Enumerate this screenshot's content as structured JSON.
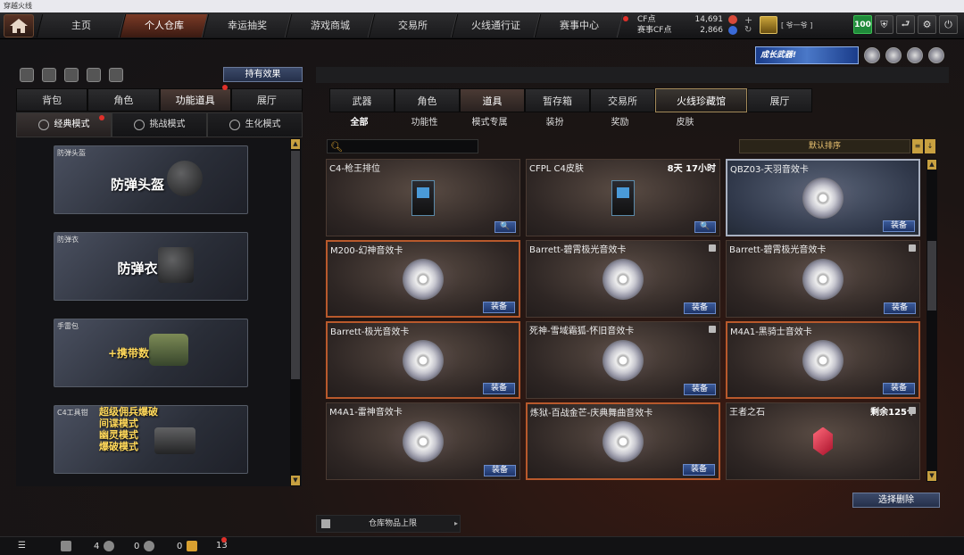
{
  "window": {
    "title": "穿越火线"
  },
  "nav": {
    "tabs": [
      "主页",
      "个人仓库",
      "幸运抽奖",
      "游戏商城",
      "交易所",
      "火线通行证",
      "赛事中心"
    ],
    "active_index": 1
  },
  "currency": {
    "cf_label": "CF点",
    "cf_value": "14,691",
    "event_label": "赛事CF点",
    "event_value": "2,866"
  },
  "rank": {
    "label": "[ 爷一爷 ]"
  },
  "level_badge": "100",
  "banner": {
    "text": "成长武器!"
  },
  "left": {
    "effect_button": "持有效果",
    "tabs": [
      "背包",
      "角色",
      "功能道具",
      "展厅"
    ],
    "active_tab_index": 2,
    "modes": [
      "经典模式",
      "挑战模式",
      "生化模式"
    ],
    "active_mode_index": 0,
    "cards": [
      {
        "name": "防弹头盔",
        "art": "防弹头盔"
      },
      {
        "name": "防弹衣",
        "art": "防弹衣"
      },
      {
        "name": "手雷包",
        "art": "+携带数"
      },
      {
        "name": "C4工具钳",
        "art_lines": [
          "超级佣兵爆破",
          "间谍模式",
          "幽灵模式",
          "爆破模式"
        ]
      }
    ]
  },
  "right": {
    "tabs": [
      "武器",
      "角色",
      "道具",
      "暂存箱",
      "交易所",
      "火线珍藏馆",
      "展厅"
    ],
    "active_tab_index": 2,
    "subtabs": [
      "全部",
      "功能性",
      "模式专属",
      "装扮",
      "奖励",
      "皮肤"
    ],
    "active_subtab_index": 0,
    "sort_label": "默认排序",
    "items": [
      {
        "name": "C4-枪王排位",
        "icon": "c4-icon",
        "button": "🔍"
      },
      {
        "name": "CFPL C4皮肤",
        "icon": "c4-icon",
        "badge": "8天 17小时",
        "button": "🔍"
      },
      {
        "name": "QBZ03-天羽音效卡",
        "icon": "disc-icon",
        "button": "装备",
        "style": "blue"
      },
      {
        "name": "M200-幻神音效卡",
        "icon": "disc-icon",
        "button": "装备",
        "style": "orange"
      },
      {
        "name": "Barrett-碧霄极光音效卡",
        "icon": "disc-icon",
        "button": "装备",
        "lock": true
      },
      {
        "name": "Barrett-碧霄极光音效卡",
        "icon": "disc-icon",
        "button": "装备",
        "lock": true
      },
      {
        "name": "Barrett-极光音效卡",
        "icon": "disc-icon",
        "button": "装备",
        "style": "orange"
      },
      {
        "name": "死神-雪域霜狐-怀旧音效卡",
        "icon": "disc-icon",
        "button": "装备",
        "lock": true
      },
      {
        "name": "M4A1-黑骑士音效卡",
        "icon": "disc-icon",
        "button": "装备",
        "style": "orange"
      },
      {
        "name": "M4A1-雷神音效卡",
        "icon": "disc-icon",
        "button": "装备"
      },
      {
        "name": "炼狱-百战金芒-庆典舞曲音效卡",
        "icon": "disc-icon",
        "button": "装备",
        "style": "orange"
      },
      {
        "name": "王者之石",
        "icon": "gem-icon",
        "badge": "剩余125个",
        "lock": true
      }
    ],
    "delete_button": "选择删除",
    "capacity_label": "仓库物品上限"
  },
  "status": {
    "count1": "4",
    "count2": "0",
    "count3": "0",
    "count4": "13"
  }
}
